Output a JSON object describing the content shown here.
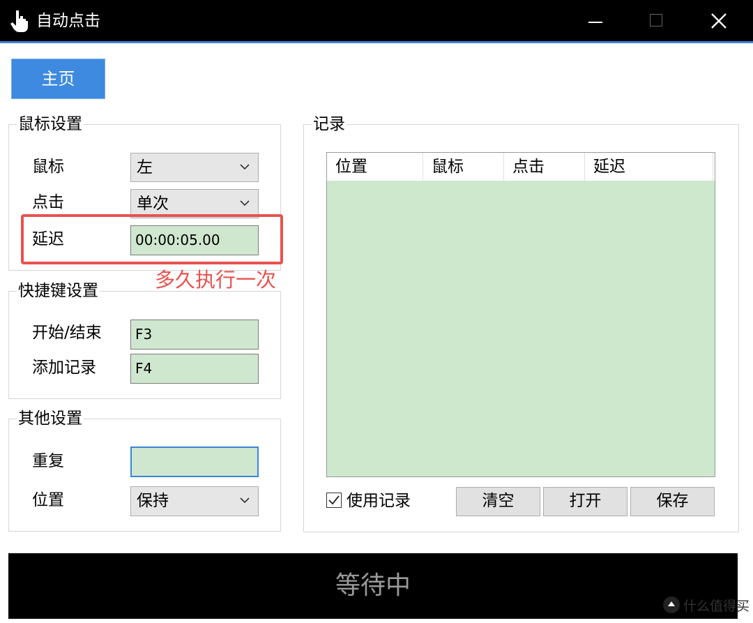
{
  "window": {
    "title": "自动点击",
    "icon": "pointing-hand-icon"
  },
  "tabs": [
    {
      "label": "主页",
      "active": true
    }
  ],
  "mouse_settings": {
    "title": "鼠标设置",
    "mouse_label": "鼠标",
    "mouse_value": "左",
    "click_label": "点击",
    "click_value": "单次",
    "delay_label": "延迟",
    "delay_value": "00:00:05.00"
  },
  "hotkey_settings": {
    "title": "快捷键设置",
    "start_stop_label": "开始/结束",
    "start_stop_value": "F3",
    "add_record_label": "添加记录",
    "add_record_value": "F4"
  },
  "other_settings": {
    "title": "其他设置",
    "repeat_label": "重复",
    "repeat_value": "",
    "position_label": "位置",
    "position_value": "保持"
  },
  "records": {
    "title": "记录",
    "columns": [
      "位置",
      "鼠标",
      "点击",
      "延迟"
    ],
    "rows": [],
    "use_records_label": "使用记录",
    "use_records_checked": true,
    "clear_label": "清空",
    "open_label": "打开",
    "save_label": "保存"
  },
  "status": "等待中",
  "annotation": "多久执行一次",
  "watermark": "什么值得买",
  "colors": {
    "accent": "#3e8ae0",
    "field_green": "#cfe7cf",
    "annotation_red": "#e8524f"
  }
}
